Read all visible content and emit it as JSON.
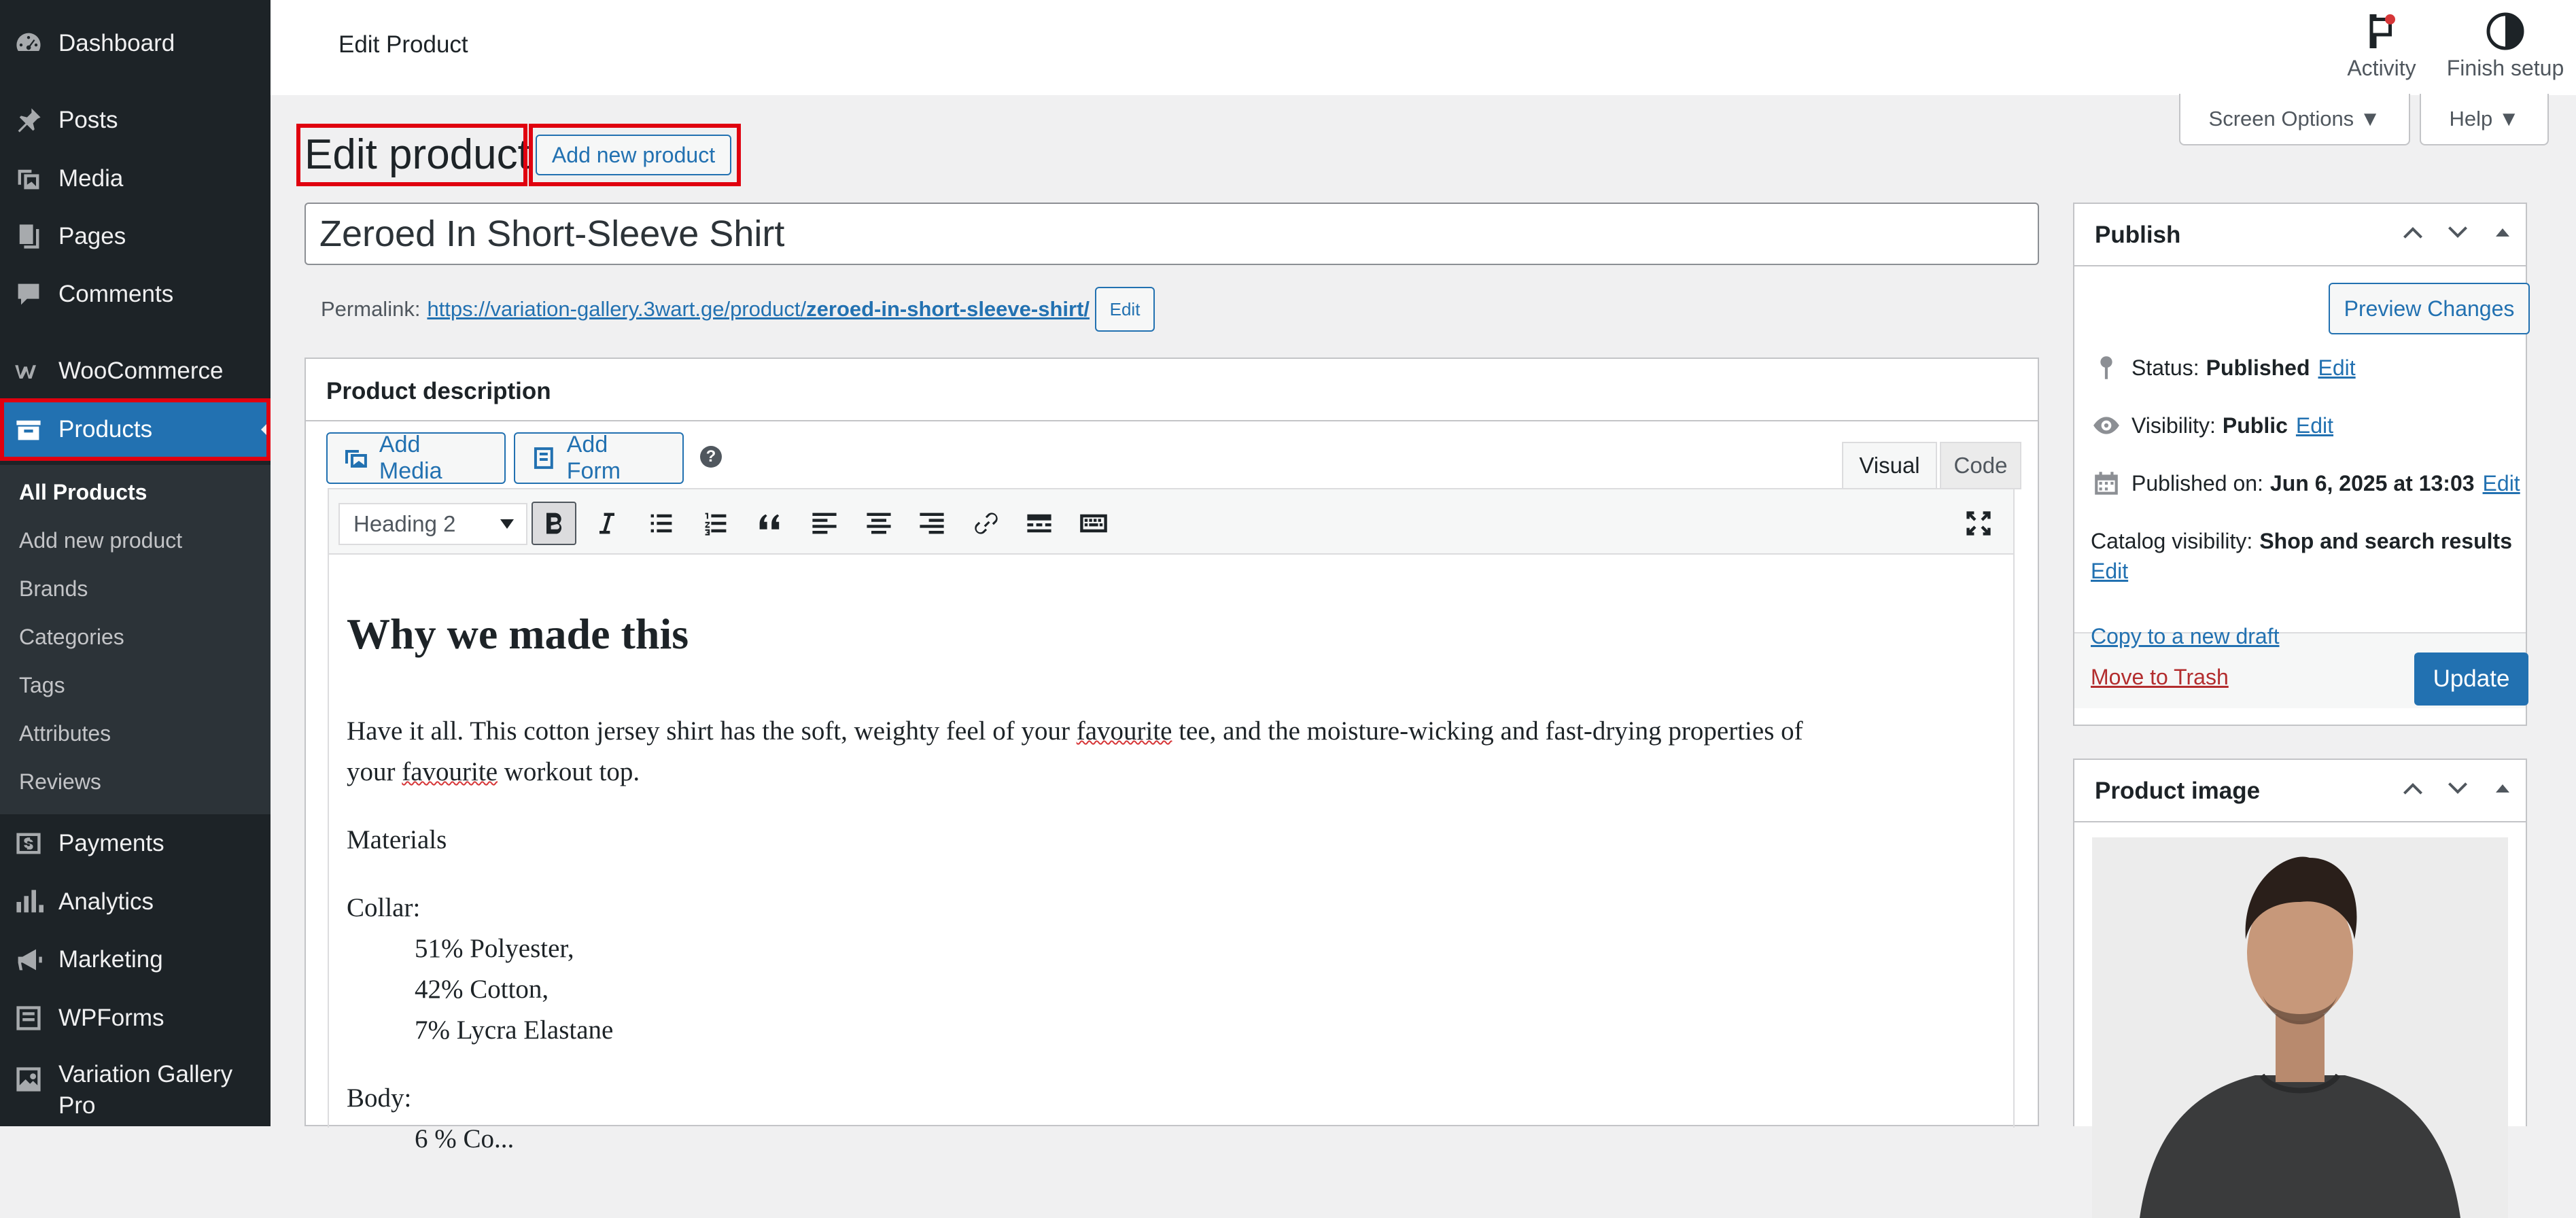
{
  "sidebar": {
    "items": [
      {
        "label": "Dashboard",
        "icon": "dashboard-icon"
      },
      {
        "label": "Posts",
        "icon": "pin-icon"
      },
      {
        "label": "Media",
        "icon": "media-icon"
      },
      {
        "label": "Pages",
        "icon": "pages-icon"
      },
      {
        "label": "Comments",
        "icon": "comment-icon"
      },
      {
        "label": "WooCommerce",
        "icon": "woo-icon"
      },
      {
        "label": "Products",
        "icon": "archive-icon"
      },
      {
        "label": "Payments",
        "icon": "payments-icon"
      },
      {
        "label": "Analytics",
        "icon": "bar-chart-icon"
      },
      {
        "label": "Marketing",
        "icon": "megaphone-icon"
      },
      {
        "label": "WPForms",
        "icon": "forms-icon"
      },
      {
        "label": "Variation Gallery",
        "label2": "Pro",
        "icon": "gallery-icon"
      }
    ],
    "submenu": [
      "All Products",
      "Add new product",
      "Brands",
      "Categories",
      "Tags",
      "Attributes",
      "Reviews"
    ]
  },
  "topbar": {
    "title": "Edit Product",
    "activity_label": "Activity",
    "finish_setup_label": "Finish setup"
  },
  "screen_options_label": "Screen Options ▼",
  "help_label": "Help ▼",
  "heading": {
    "title": "Edit product",
    "add_new_label": "Add new product"
  },
  "product": {
    "title": "Zeroed In Short-Sleeve Shirt",
    "permalink_label": "Permalink:",
    "permalink_base": "https://variation-gallery.3wart.ge/product/",
    "permalink_slug": "zeroed-in-short-sleeve-shirt/",
    "permalink_edit": "Edit"
  },
  "description": {
    "box_title": "Product description",
    "add_media": "Add Media",
    "add_form": "Add Form",
    "help": "?",
    "tab_visual": "Visual",
    "tab_code": "Code",
    "format": "Heading 2",
    "heading": "Why we made this",
    "para1_a": "Have it all. This cotton jersey shirt has the soft, weighty feel of your ",
    "para1_word": "favourite",
    "para1_b": " tee, and the moisture-wicking and fast-drying properties of",
    "para1_c": "your ",
    "para1_d": " workout top.",
    "materials": "Materials",
    "collar": "Collar:",
    "collar_items": [
      "51% Polyester,",
      "42% Cotton,",
      "7% Lycra Elastane"
    ],
    "body": "Body:",
    "body_partial": "6 % Co..."
  },
  "publish": {
    "title": "Publish",
    "preview_label": "Preview Changes",
    "status_label": "Status:",
    "status_value": "Published",
    "visibility_label": "Visibility:",
    "visibility_value": "Public",
    "published_label": "Published on:",
    "published_value": "Jun 6, 2025 at 13:03",
    "catalog_label": "Catalog visibility:",
    "catalog_value": "Shop and search results",
    "edit": "Edit",
    "copy_draft": "Copy to a new draft",
    "trash": "Move to Trash",
    "update": "Update"
  },
  "product_image": {
    "title": "Product image"
  },
  "colors": {
    "accent": "#2271b1",
    "sidebar": "#1d2327",
    "highlight": "#e0000f",
    "trash": "#b32d2e"
  }
}
